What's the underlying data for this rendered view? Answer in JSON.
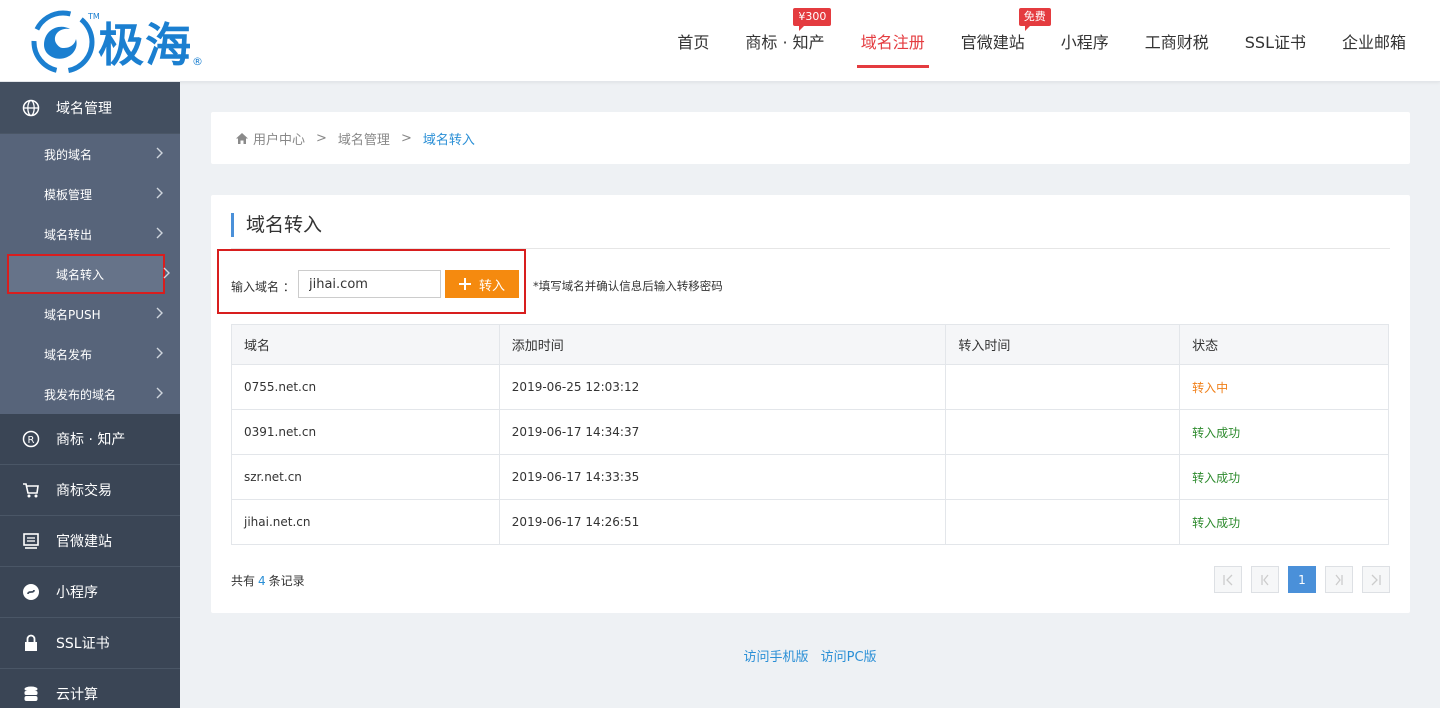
{
  "brand": {
    "name": "极海",
    "tm": "TM",
    "reg": "®"
  },
  "nav": {
    "items": [
      {
        "label": "首页",
        "badge": null
      },
      {
        "label": "商标 · 知产",
        "badge": "¥300"
      },
      {
        "label": "域名注册",
        "badge": null,
        "active": true
      },
      {
        "label": "官微建站",
        "badge": "免费"
      },
      {
        "label": "小程序",
        "badge": null
      },
      {
        "label": "工商财税",
        "badge": null
      },
      {
        "label": "SSL证书",
        "badge": null
      },
      {
        "label": "企业邮箱",
        "badge": null
      }
    ]
  },
  "sidebar": {
    "domain_group": "域名管理",
    "sub_items": [
      "我的域名",
      "模板管理",
      "域名转出",
      "域名转入",
      "域名PUSH",
      "域名发布",
      "我发布的域名"
    ],
    "groups": [
      "商标 · 知产",
      "商标交易",
      "官微建站",
      "小程序",
      "SSL证书",
      "云计算"
    ]
  },
  "breadcrumb": {
    "home": "用户中心",
    "sep": ">",
    "level2": "域名管理",
    "current": "域名转入"
  },
  "main": {
    "title": "域名转入",
    "input_label": "输入域名 ：",
    "input_value": "jihai.com",
    "button_label": "转入",
    "hint": "*填写域名并确认信息后输入转移密码"
  },
  "table": {
    "headers": [
      "域名",
      "添加时间",
      "转入时间",
      "状态"
    ],
    "rows": [
      {
        "domain": "0755.net.cn",
        "added": "2019-06-25 12:03:12",
        "transferred": "",
        "status": "转入中"
      },
      {
        "domain": "0391.net.cn",
        "added": "2019-06-17 14:34:37",
        "transferred": "",
        "status": "转入成功"
      },
      {
        "domain": "szr.net.cn",
        "added": "2019-06-17 14:33:35",
        "transferred": "",
        "status": "转入成功"
      },
      {
        "domain": "jihai.net.cn",
        "added": "2019-06-17 14:26:51",
        "transferred": "",
        "status": "转入成功"
      }
    ]
  },
  "summary": {
    "prefix": "共有",
    "count": "4",
    "suffix": "条记录"
  },
  "pager": {
    "current": "1"
  },
  "footer": {
    "mobile": "访问手机版",
    "pc": "访问PC版"
  },
  "colors": {
    "accent_red": "#e43b3f",
    "link_blue": "#2a8fd6",
    "button_orange": "#f58a0f",
    "sidebar_bg": "#404c5c",
    "pending": "#f0801a",
    "success": "#2e8b2e"
  }
}
